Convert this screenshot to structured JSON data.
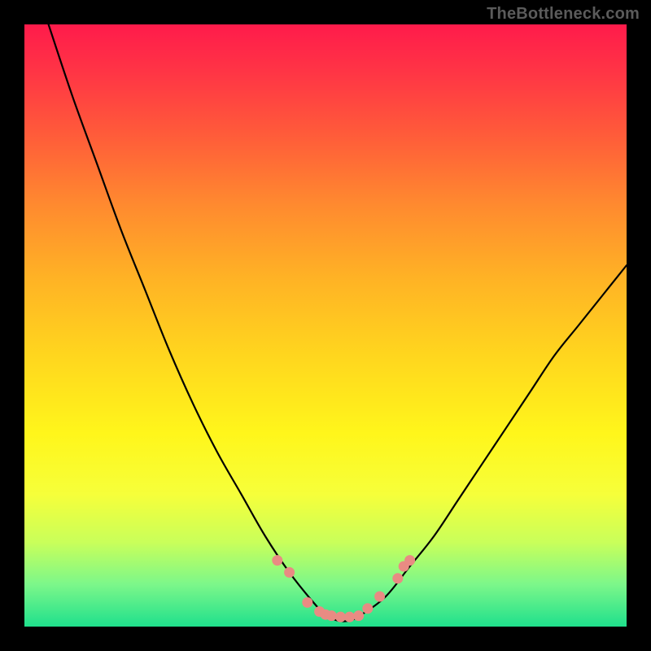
{
  "watermark": "TheBottleneck.com",
  "chart_data": {
    "type": "line",
    "title": "",
    "xlabel": "",
    "ylabel": "",
    "xlim": [
      0,
      100
    ],
    "ylim": [
      0,
      100
    ],
    "grid": false,
    "series": [
      {
        "name": "bottleneck-curve",
        "x": [
          4,
          8,
          12,
          16,
          20,
          24,
          28,
          32,
          36,
          40,
          44,
          48,
          50,
          52,
          54,
          56,
          60,
          64,
          68,
          72,
          76,
          80,
          84,
          88,
          92,
          96,
          100
        ],
        "y": [
          100,
          88,
          77,
          66,
          56,
          46,
          37,
          29,
          22,
          15,
          9,
          4,
          2,
          1,
          1,
          2,
          5,
          10,
          15,
          21,
          27,
          33,
          39,
          45,
          50,
          55,
          60
        ]
      }
    ],
    "markers": {
      "name": "trough-markers",
      "color": "#e98b83",
      "points": [
        {
          "x": 42,
          "y": 11
        },
        {
          "x": 44,
          "y": 9
        },
        {
          "x": 47,
          "y": 4
        },
        {
          "x": 49,
          "y": 2.5
        },
        {
          "x": 50,
          "y": 2
        },
        {
          "x": 51,
          "y": 1.8
        },
        {
          "x": 52.5,
          "y": 1.6
        },
        {
          "x": 54,
          "y": 1.6
        },
        {
          "x": 55.5,
          "y": 1.8
        },
        {
          "x": 57,
          "y": 3
        },
        {
          "x": 59,
          "y": 5
        },
        {
          "x": 62,
          "y": 8
        },
        {
          "x": 63,
          "y": 10
        },
        {
          "x": 64,
          "y": 11
        }
      ]
    },
    "background_gradient": {
      "top": "#ff1b4b",
      "mid": "#ffe61d",
      "bottom": "#1fe08c"
    }
  }
}
